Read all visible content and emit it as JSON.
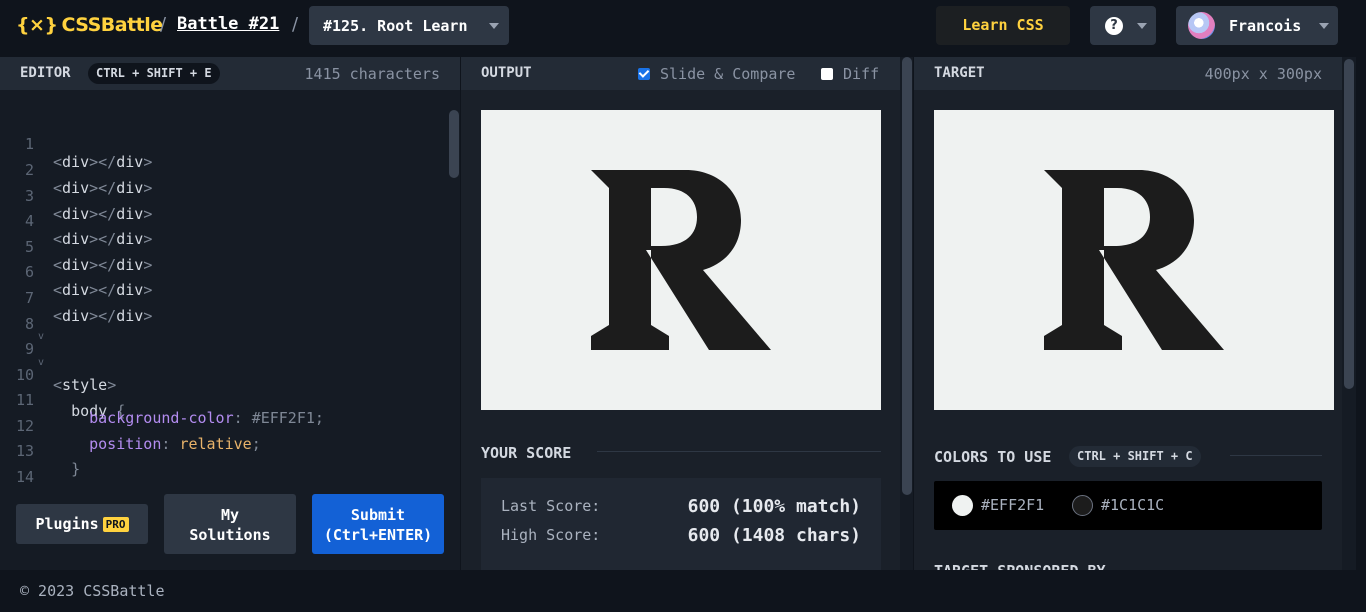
{
  "header": {
    "logo_text": "CSSBattle",
    "logo_mark": "{×}",
    "separator": "/",
    "battle_label": "Battle #21",
    "target_label": "#125. Root Learn",
    "learn_css_label": "Learn CSS",
    "help_label": "?",
    "user_name": "Francois"
  },
  "editor": {
    "title": "EDITOR",
    "shortcut": "CTRL + SHIFT + E",
    "char_count": "1415 characters",
    "line_numbers": [
      "1",
      "2",
      "3",
      "4",
      "5",
      "6",
      "7",
      "8",
      "9",
      "10",
      "11",
      "12",
      "13",
      "14"
    ],
    "lines": {
      "div_lt": "<",
      "div_tag": "div",
      "div_mid": "></",
      "div_gt": ">",
      "style_lt": "<",
      "style_tag": "style",
      "style_gt": ">",
      "body_sel": "body",
      "brace_open": "{",
      "prop1": "background-color",
      "val1": "#EFF2F1",
      "prop2": "position",
      "val2": "relative",
      "colon": ":",
      "semi": ";",
      "brace_close": "}"
    },
    "buttons": {
      "plugins": "Plugins",
      "pro": "PRO",
      "my_solutions_1": "My",
      "my_solutions_2": "Solutions",
      "submit_1": "Submit",
      "submit_2": "(Ctrl+ENTER)"
    }
  },
  "output": {
    "title": "OUTPUT",
    "slide_compare": "Slide & Compare",
    "diff": "Diff",
    "glyph": "R",
    "score_title": "YOUR SCORE",
    "last_score_label": "Last Score:",
    "last_score_value": "600 (100% match)",
    "high_score_label": "High Score:",
    "high_score_value": "600 (1408 chars)"
  },
  "target": {
    "title": "TARGET",
    "size": "400px x 300px",
    "glyph": "R",
    "colors_title": "COLORS TO USE",
    "colors_shortcut": "CTRL + SHIFT + C",
    "color_1": "#EFF2F1",
    "color_2": "#1C1C1C",
    "sponsored": "TARGET SPONSORED BY"
  },
  "footer": {
    "copyright": "© 2023 CSSBattle"
  },
  "theme": {
    "accent": "#ffd23f",
    "submit_blue": "#1361d6",
    "canvas_bg": "#EFF2F1",
    "glyph_color": "#1C1C1C"
  }
}
